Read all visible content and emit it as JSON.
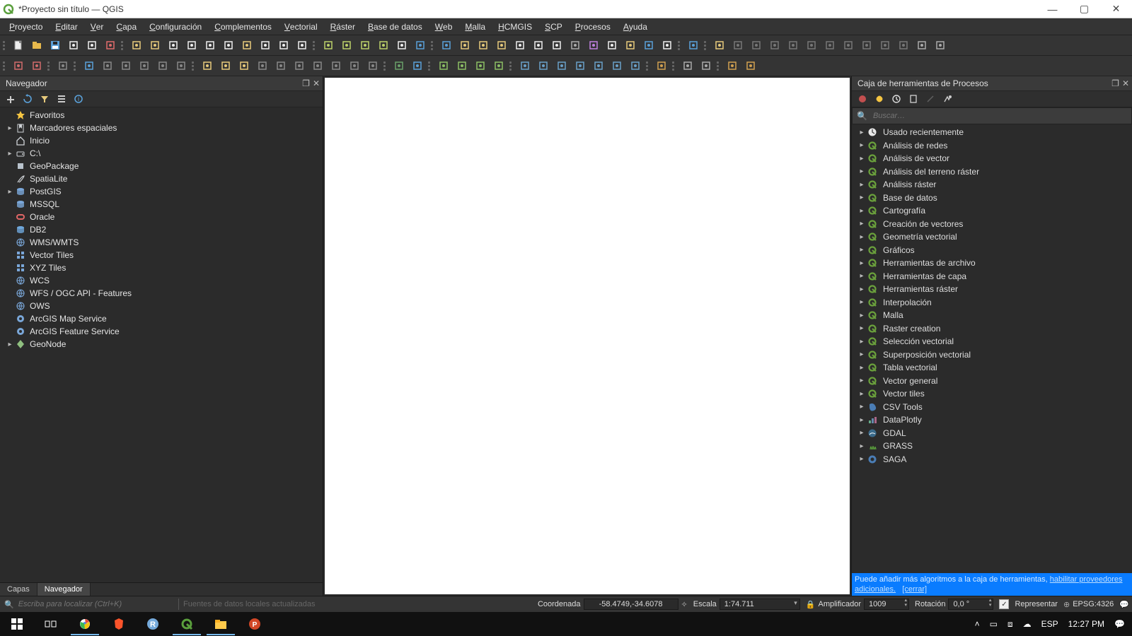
{
  "window": {
    "title": "*Proyecto sin título — QGIS"
  },
  "menubar": {
    "items": [
      "Proyecto",
      "Editar",
      "Ver",
      "Capa",
      "Configuración",
      "Complementos",
      "Vectorial",
      "Ráster",
      "Base de datos",
      "Web",
      "Malla",
      "HCMGIS",
      "SCP",
      "Procesos",
      "Ayuda"
    ]
  },
  "browser_panel": {
    "title": "Navegador",
    "tabs": {
      "layers": "Capas",
      "browser": "Navegador"
    },
    "items": [
      {
        "expandable": false,
        "icon": "star",
        "label": "Favoritos",
        "color": "#f5c542"
      },
      {
        "expandable": true,
        "icon": "bookmark",
        "label": "Marcadores espaciales",
        "color": "#cfd3d7"
      },
      {
        "expandable": false,
        "icon": "home",
        "label": "Inicio",
        "color": "#cfd3d7"
      },
      {
        "expandable": true,
        "icon": "drive",
        "label": "C:\\",
        "color": "#cfd3d7"
      },
      {
        "expandable": false,
        "icon": "gpkg",
        "label": "GeoPackage",
        "color": "#b8c2cc"
      },
      {
        "expandable": false,
        "icon": "feather",
        "label": "SpatiaLite",
        "color": "#cfd3d7"
      },
      {
        "expandable": true,
        "icon": "postgis",
        "label": "PostGIS",
        "color": "#7aa7d9"
      },
      {
        "expandable": false,
        "icon": "mssql",
        "label": "MSSQL",
        "color": "#7aa7d9"
      },
      {
        "expandable": false,
        "icon": "oracle",
        "label": "Oracle",
        "color": "#e06666"
      },
      {
        "expandable": false,
        "icon": "db2",
        "label": "DB2",
        "color": "#6fa8dc"
      },
      {
        "expandable": false,
        "icon": "globe",
        "label": "WMS/WMTS",
        "color": "#7aa7d9"
      },
      {
        "expandable": false,
        "icon": "grid",
        "label": "Vector Tiles",
        "color": "#7aa7d9"
      },
      {
        "expandable": false,
        "icon": "grid",
        "label": "XYZ Tiles",
        "color": "#7aa7d9"
      },
      {
        "expandable": false,
        "icon": "globe",
        "label": "WCS",
        "color": "#7aa7d9"
      },
      {
        "expandable": false,
        "icon": "globe",
        "label": "WFS / OGC API - Features",
        "color": "#7aa7d9"
      },
      {
        "expandable": false,
        "icon": "globe",
        "label": "OWS",
        "color": "#7aa7d9"
      },
      {
        "expandable": false,
        "icon": "arcgis",
        "label": "ArcGIS Map Service",
        "color": "#7aa7d9"
      },
      {
        "expandable": false,
        "icon": "arcgis",
        "label": "ArcGIS Feature Service",
        "color": "#7aa7d9"
      },
      {
        "expandable": true,
        "icon": "node",
        "label": "GeoNode",
        "color": "#8fbf7f"
      }
    ]
  },
  "processing_panel": {
    "title": "Caja de herramientas de Procesos",
    "search_placeholder": "Buscar…",
    "categories": [
      {
        "icon": "clock",
        "label": "Usado recientemente"
      },
      {
        "icon": "qgis",
        "label": "Análisis de redes"
      },
      {
        "icon": "qgis",
        "label": "Análisis de vector"
      },
      {
        "icon": "qgis",
        "label": "Análisis del terreno ráster"
      },
      {
        "icon": "qgis",
        "label": "Análisis ráster"
      },
      {
        "icon": "qgis",
        "label": "Base de datos"
      },
      {
        "icon": "qgis",
        "label": "Cartografía"
      },
      {
        "icon": "qgis",
        "label": "Creación de vectores"
      },
      {
        "icon": "qgis",
        "label": "Geometría vectorial"
      },
      {
        "icon": "qgis",
        "label": "Gráficos"
      },
      {
        "icon": "qgis",
        "label": "Herramientas de archivo"
      },
      {
        "icon": "qgis",
        "label": "Herramientas de capa"
      },
      {
        "icon": "qgis",
        "label": "Herramientas ráster"
      },
      {
        "icon": "qgis",
        "label": "Interpolación"
      },
      {
        "icon": "qgis",
        "label": "Malla"
      },
      {
        "icon": "qgis",
        "label": "Raster creation"
      },
      {
        "icon": "qgis",
        "label": "Selección vectorial"
      },
      {
        "icon": "qgis",
        "label": "Superposición vectorial"
      },
      {
        "icon": "qgis",
        "label": "Tabla vectorial"
      },
      {
        "icon": "qgis",
        "label": "Vector general"
      },
      {
        "icon": "qgis",
        "label": "Vector tiles"
      },
      {
        "icon": "csv",
        "label": "CSV Tools"
      },
      {
        "icon": "chart",
        "label": "DataPlotly"
      },
      {
        "icon": "gdal",
        "label": "GDAL"
      },
      {
        "icon": "grass",
        "label": "GRASS"
      },
      {
        "icon": "saga",
        "label": "SAGA"
      }
    ],
    "hint_text": "Puede añadir más algoritmos a la caja de herramientas, ",
    "hint_link1": "habilitar proveedores adicionales.",
    "hint_link2": "[cerrar]"
  },
  "statusbar": {
    "search_placeholder": "Escriba para localizar (Ctrl+K)",
    "message": "Fuentes de datos locales actualizadas",
    "coord_label": "Coordenada",
    "coord_value": "-58.4749,-34.6078",
    "scale_label": "Escala",
    "scale_value": "1:74.711",
    "magnifier_label": "Amplificador",
    "magnifier_value": "1009",
    "rotation_label": "Rotación",
    "rotation_value": "0,0 °",
    "render_label": "Representar",
    "crs_value": "EPSG:4326"
  },
  "taskbar": {
    "lang": "ESP",
    "clock": "12:27 PM"
  },
  "toolbar1_groups": [
    {
      "icons": [
        {
          "name": "new-project-icon",
          "svg": "page",
          "c": "#eee"
        },
        {
          "name": "open-project-icon",
          "svg": "folder",
          "c": "#e6b84c"
        },
        {
          "name": "save-project-icon",
          "svg": "floppy",
          "c": "#5aa0d8"
        },
        {
          "name": "new-layout-icon",
          "svg": "layout",
          "c": "#eee"
        },
        {
          "name": "layout-manager-icon",
          "svg": "layout2",
          "c": "#eee"
        },
        {
          "name": "style-manager-icon",
          "svg": "palette",
          "c": "#e06b6b"
        }
      ]
    },
    {
      "icons": [
        {
          "name": "pan-icon",
          "svg": "hand",
          "c": "#e6c97b"
        },
        {
          "name": "pan-selection-icon",
          "svg": "hand2",
          "c": "#e6c97b"
        },
        {
          "name": "zoom-in-icon",
          "svg": "zoom+",
          "c": "#eee"
        },
        {
          "name": "zoom-out-icon",
          "svg": "zoom-",
          "c": "#eee"
        },
        {
          "name": "zoom-native-icon",
          "svg": "zoom1",
          "c": "#eee"
        },
        {
          "name": "zoom-full-icon",
          "svg": "zoomfull",
          "c": "#eee"
        },
        {
          "name": "zoom-selection-icon",
          "svg": "zoomsel",
          "c": "#e6c97b"
        },
        {
          "name": "zoom-layer-icon",
          "svg": "zoomlyr",
          "c": "#eee"
        },
        {
          "name": "zoom-last-icon",
          "svg": "zoomlast",
          "c": "#eee"
        },
        {
          "name": "zoom-next-icon",
          "svg": "zoomnext",
          "c": "#eee"
        }
      ]
    },
    {
      "icons": [
        {
          "name": "new-map-view-icon",
          "svg": "mapview",
          "c": "#bcd16a"
        },
        {
          "name": "new-3d-view-icon",
          "svg": "cube",
          "c": "#bcd16a"
        },
        {
          "name": "new-bookmark-icon",
          "svg": "bookmark",
          "c": "#bcd16a"
        },
        {
          "name": "bookmarks-icon",
          "svg": "bookmarks",
          "c": "#bcd16a"
        },
        {
          "name": "temporal-icon",
          "svg": "clock",
          "c": "#eee"
        },
        {
          "name": "refresh-icon",
          "svg": "refresh",
          "c": "#5aa0d8"
        }
      ]
    },
    {
      "icons": [
        {
          "name": "identify-icon",
          "svg": "info",
          "c": "#5aa0d8"
        },
        {
          "name": "actions-icon",
          "svg": "bolt",
          "c": "#e6c97b"
        },
        {
          "name": "select-features-icon",
          "svg": "select",
          "c": "#e6c97b"
        },
        {
          "name": "select-value-icon",
          "svg": "selectv",
          "c": "#e6c97b"
        },
        {
          "name": "deselect-icon",
          "svg": "deselect",
          "c": "#eee"
        },
        {
          "name": "attribute-table-icon",
          "svg": "table",
          "c": "#eee"
        },
        {
          "name": "field-calculator-icon",
          "svg": "calc",
          "c": "#eee"
        },
        {
          "name": "toolbox-icon",
          "svg": "gear",
          "c": "#aaa"
        },
        {
          "name": "statistics-icon",
          "svg": "sigma",
          "c": "#c080e0"
        },
        {
          "name": "measure-icon",
          "svg": "ruler",
          "c": "#eee"
        },
        {
          "name": "map-tips-icon",
          "svg": "tip",
          "c": "#e6c97b"
        },
        {
          "name": "annotation-icon",
          "svg": "note",
          "c": "#5aa0d8"
        },
        {
          "name": "text-annotation-icon",
          "svg": "text",
          "c": "#eee"
        }
      ]
    },
    {
      "icons": [
        {
          "name": "help-icon",
          "svg": "help",
          "c": "#5aa0d8"
        }
      ]
    },
    {
      "icons": [
        {
          "name": "toggle-editing-icon",
          "svg": "pencil",
          "c": "#e6c97b"
        },
        {
          "name": "save-edits-icon",
          "svg": "saveedit",
          "c": "#777"
        },
        {
          "name": "add-feature-icon",
          "svg": "addpt",
          "c": "#777"
        },
        {
          "name": "digitize-shape-icon",
          "svg": "shape",
          "c": "#777"
        },
        {
          "name": "move-feature-icon",
          "svg": "move",
          "c": "#777"
        },
        {
          "name": "vertex-tool-icon",
          "svg": "vertex",
          "c": "#777"
        },
        {
          "name": "modify-attrs-icon",
          "svg": "attrs",
          "c": "#777"
        },
        {
          "name": "delete-selected-icon",
          "svg": "trash",
          "c": "#777"
        },
        {
          "name": "cut-features-icon",
          "svg": "cut",
          "c": "#777"
        },
        {
          "name": "copy-features-icon",
          "svg": "copy",
          "c": "#777"
        },
        {
          "name": "paste-features-icon",
          "svg": "paste",
          "c": "#777"
        },
        {
          "name": "undo-icon",
          "svg": "undo",
          "c": "#aaa"
        },
        {
          "name": "redo-icon",
          "svg": "redo",
          "c": "#aaa"
        }
      ]
    }
  ],
  "toolbar2_groups": [
    {
      "icons": [
        {
          "name": "show-editor-icon",
          "svg": "editor",
          "c": "#d06b6b"
        },
        {
          "name": "qscp-icon",
          "svg": "scp",
          "c": "#d06b6b"
        }
      ]
    },
    {
      "icons": [
        {
          "name": "pin-icon",
          "svg": "pin",
          "c": "#888"
        }
      ]
    },
    {
      "icons": [
        {
          "name": "data-source-manager-icon",
          "svg": "dsm",
          "c": "#5aa0d8"
        },
        {
          "name": "new-geopackage-icon",
          "svg": "ngpkg",
          "c": "#888"
        },
        {
          "name": "new-shapefile-icon",
          "svg": "nshp",
          "c": "#888"
        },
        {
          "name": "new-spatialite-icon",
          "svg": "nspat",
          "c": "#888"
        },
        {
          "name": "new-memory-icon",
          "svg": "nmem",
          "c": "#888"
        },
        {
          "name": "new-virtual-icon",
          "svg": "nvirt",
          "c": "#888"
        }
      ]
    },
    {
      "icons": [
        {
          "name": "labels-icon",
          "svg": "label",
          "c": "#e6c97b"
        },
        {
          "name": "labels-rule-icon",
          "svg": "labelr",
          "c": "#e6c97b"
        },
        {
          "name": "diagram-icon",
          "svg": "diag",
          "c": "#e6c97b"
        },
        {
          "name": "auto-placement-icon",
          "svg": "autopl",
          "c": "#888"
        },
        {
          "name": "highlight-pinned-icon",
          "svg": "hpin",
          "c": "#888"
        },
        {
          "name": "pin-labels-icon",
          "svg": "pinl",
          "c": "#888"
        },
        {
          "name": "show-hide-labels-icon",
          "svg": "showl",
          "c": "#888"
        },
        {
          "name": "move-label-icon",
          "svg": "movel",
          "c": "#888"
        },
        {
          "name": "rotate-label-icon",
          "svg": "rotl",
          "c": "#888"
        },
        {
          "name": "change-label-icon",
          "svg": "chgl",
          "c": "#888"
        }
      ]
    },
    {
      "icons": [
        {
          "name": "osm-place-search-icon",
          "svg": "osm",
          "c": "#6aa06a"
        },
        {
          "name": "python-console-icon",
          "svg": "python",
          "c": "#5aa0d8"
        }
      ]
    },
    {
      "icons": [
        {
          "name": "add-point-icon",
          "svg": "addpt2",
          "c": "#8cbf65"
        },
        {
          "name": "add-line-icon",
          "svg": "addln",
          "c": "#8cbf65"
        },
        {
          "name": "add-polygon-icon",
          "svg": "addpg",
          "c": "#8cbf65"
        },
        {
          "name": "add-rect-icon",
          "svg": "addrct",
          "c": "#8cbf65"
        }
      ]
    },
    {
      "icons": [
        {
          "name": "add-wms-icon",
          "svg": "wms",
          "c": "#6aa0c8"
        },
        {
          "name": "add-wfs-icon",
          "svg": "wfs",
          "c": "#6aa0c8"
        },
        {
          "name": "add-wcs-icon",
          "svg": "wcs",
          "c": "#6aa0c8"
        },
        {
          "name": "add-xyz-icon",
          "svg": "xyz",
          "c": "#6aa0c8"
        },
        {
          "name": "add-vtiles-icon",
          "svg": "vtiles",
          "c": "#6aa0c8"
        },
        {
          "name": "add-arcgis-map-icon",
          "svg": "agm",
          "c": "#6aa0c8"
        },
        {
          "name": "add-arcgis-feat-icon",
          "svg": "agf",
          "c": "#6aa0c8"
        }
      ]
    },
    {
      "icons": [
        {
          "name": "georef-icon",
          "svg": "georef",
          "c": "#d0a050"
        }
      ]
    },
    {
      "icons": [
        {
          "name": "plugin-manager-icon",
          "svg": "plugin",
          "c": "#aaa"
        },
        {
          "name": "plugin-a-icon",
          "svg": "pluga",
          "c": "#aaa"
        }
      ]
    },
    {
      "icons": [
        {
          "name": "raster-calc-icon",
          "svg": "rcalc",
          "c": "#d0a050"
        },
        {
          "name": "align-raster-icon",
          "svg": "align",
          "c": "#d0a050"
        }
      ]
    }
  ]
}
